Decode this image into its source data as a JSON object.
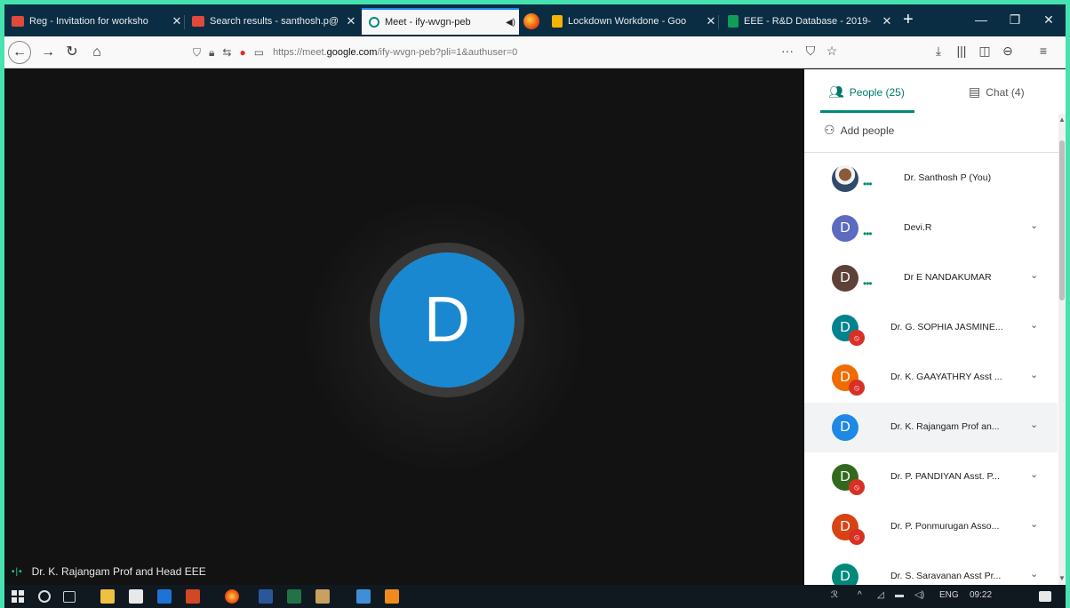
{
  "browser": {
    "tabs": [
      {
        "label": "Reg - Invitation for worksho",
        "icon": "gmail-icon",
        "active": false
      },
      {
        "label": "Search results - santhosh.p@",
        "icon": "gmail-icon",
        "active": false
      },
      {
        "label": "Meet - ify-wvgn-peb",
        "icon": "meet-icon",
        "active": true
      },
      {
        "label": "Lockdown Workdone - Goo",
        "icon": "slides-icon",
        "active": false
      },
      {
        "label": "EEE - R&D Database - 2019-",
        "icon": "sheets-icon",
        "active": false
      }
    ],
    "close_glyph": "✕",
    "new_tab": "+",
    "window": {
      "minimize": "—",
      "maximize": "❐",
      "close": "✕"
    },
    "url_prefix": "https://meet.",
    "url_domain": "google.com",
    "url_suffix": "/ify-wvgn-peb?pli=1&authuser=0",
    "url_more": "···"
  },
  "meeting": {
    "presenter_initial": "D",
    "caption_name": "Dr. K. Rajangam Prof and Head EEE"
  },
  "panel": {
    "people_tab": "People (25)",
    "chat_tab": "Chat (4)",
    "add_people": "Add people",
    "participants": [
      {
        "name": "Dr. Santhosh P (You)",
        "initial": "",
        "color": "#8a6a4a",
        "status": "speaking",
        "menu": false
      },
      {
        "name": "Devi.R",
        "initial": "D",
        "color": "#5c6bc0",
        "status": "speaking",
        "menu": true
      },
      {
        "name": "Dr E NANDAKUMAR",
        "initial": "D",
        "color": "#5d4037",
        "status": "speaking",
        "menu": true
      },
      {
        "name": "Dr. G. SOPHIA JASMINE...",
        "initial": "D",
        "color": "#00838f",
        "status": "muted",
        "menu": true
      },
      {
        "name": "Dr. K. GAAYATHRY Asst ...",
        "initial": "D",
        "color": "#ef6c00",
        "status": "muted",
        "menu": true
      },
      {
        "name": "Dr. K. Rajangam Prof an...",
        "initial": "D",
        "color": "#1e88e5",
        "status": "active",
        "menu": true
      },
      {
        "name": "Dr. P. PANDIYAN Asst. P...",
        "initial": "D",
        "color": "#33691e",
        "status": "muted",
        "menu": true
      },
      {
        "name": "Dr. P. Ponmurugan Asso...",
        "initial": "D",
        "color": "#d84315",
        "status": "muted",
        "menu": true
      },
      {
        "name": "Dr. S. Saravanan Asst Pr...",
        "initial": "D",
        "color": "#00897b",
        "status": "active",
        "menu": true
      }
    ]
  },
  "taskbar": {
    "language": "ENG",
    "time": "09:22"
  },
  "colors": {
    "accent_teal": "#00897b",
    "avatar_blue": "#1a88d0",
    "mute_red": "#d93025"
  }
}
